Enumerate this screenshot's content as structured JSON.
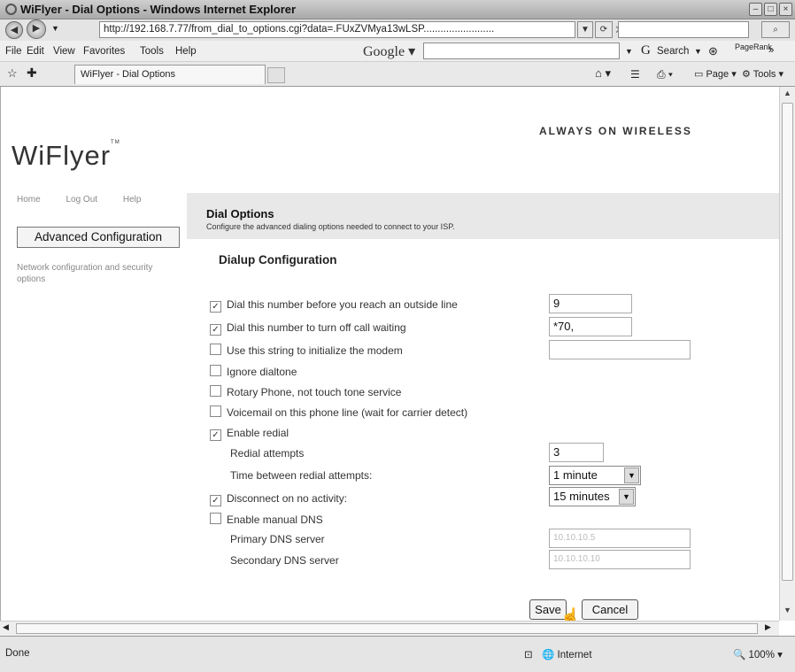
{
  "window": {
    "title": "WiFlyer - Dial Options - Windows Internet Explorer",
    "url": "http://192.168.7.77/from_dial_to_options.cgi?data=.FUxZVMya13wLSP.........................",
    "menu": [
      "File",
      "Edit",
      "View",
      "Favorites",
      "Tools",
      "Help"
    ],
    "google_label": "Google",
    "search_label": "Search",
    "pagerank_label": "PageRank",
    "tab_label": "WiFlyer - Dial Options",
    "page_label": "Page",
    "tools_label": "Tools",
    "status_text": "Done",
    "zone_text": "Internet",
    "zoom_text": "100%"
  },
  "page": {
    "brand_tagline": "ALWAYS ON WIRELESS",
    "logo_text": "WiFlyer",
    "logo_tm": "TM",
    "nav_links": [
      "Home",
      "Log Out",
      "Help"
    ],
    "adv_button": "Advanced Configuration",
    "side_note": "Network configuration and security options",
    "title": "Dial Options",
    "subtitle": "Configure the advanced dialing options needed to connect to your ISP.",
    "section_title": "Dialup Configuration",
    "options": [
      {
        "label": "Dial this number before you reach an outside line",
        "checked": true,
        "value": "9"
      },
      {
        "label": "Dial this number to turn off call waiting",
        "checked": true,
        "value": "*70,"
      },
      {
        "label": "Use this string to initialize the modem",
        "checked": false,
        "value": ""
      },
      {
        "label": "Ignore dialtone",
        "checked": false
      },
      {
        "label": "Rotary Phone, not touch tone service",
        "checked": false
      },
      {
        "label": "Voicemail on this phone line (wait for carrier detect)",
        "checked": false
      },
      {
        "label": "Enable redial",
        "checked": true
      }
    ],
    "redial_attempts_label": "Redial attempts",
    "redial_attempts_value": "3",
    "redial_time_label": "Time between redial attempts:",
    "redial_time_value": "1 minute",
    "disconnect_label": "Disconnect on no activity:",
    "disconnect_checked": true,
    "disconnect_value": "15 minutes",
    "manual_dns_label": "Enable manual DNS",
    "manual_dns_checked": false,
    "primary_dns_label": "Primary DNS server",
    "primary_dns_value": "10.10.10.5",
    "secondary_dns_label": "Secondary DNS server",
    "secondary_dns_value": "10.10.10.10",
    "save_button": "Save",
    "cancel_button": "Cancel"
  }
}
